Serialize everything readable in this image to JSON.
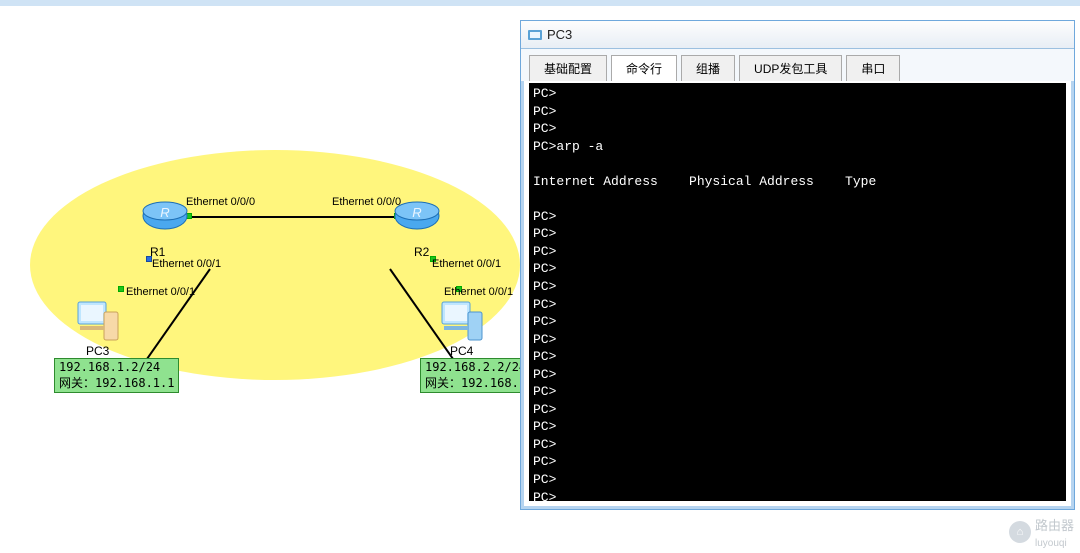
{
  "window": {
    "title": "PC3"
  },
  "tabs": [
    {
      "label": "基础配置"
    },
    {
      "label": "命令行"
    },
    {
      "label": "组播"
    },
    {
      "label": "UDP发包工具"
    },
    {
      "label": "串口"
    }
  ],
  "active_tab_index": 1,
  "terminal_lines": [
    "PC>",
    "PC>",
    "PC>",
    "PC>arp -a",
    "",
    "Internet Address    Physical Address    Type",
    "",
    "PC>",
    "PC>",
    "PC>",
    "PC>",
    "PC>",
    "PC>",
    "PC>",
    "PC>",
    "PC>",
    "PC>",
    "PC>",
    "PC>",
    "PC>",
    "PC>",
    "PC>",
    "PC>",
    "PC>"
  ],
  "topology": {
    "routers": [
      {
        "name": "R1",
        "iface_top": "Ethernet 0/0/0",
        "iface_bot": "Ethernet 0/0/1"
      },
      {
        "name": "R2",
        "iface_top": "Ethernet 0/0/0",
        "iface_bot": "Ethernet 0/0/1"
      }
    ],
    "pcs": [
      {
        "name": "PC3",
        "iface": "Ethernet 0/0/1",
        "ip": "192.168.1.2/24",
        "gw_label": "网关：192.168.1.1"
      },
      {
        "name": "PC4",
        "iface": "Ethernet 0/0/1",
        "ip": "192.168.2.2/24",
        "gw_label": "网关：192.168."
      }
    ]
  },
  "watermark": {
    "text": "路由器",
    "sub": "luyouqi"
  }
}
